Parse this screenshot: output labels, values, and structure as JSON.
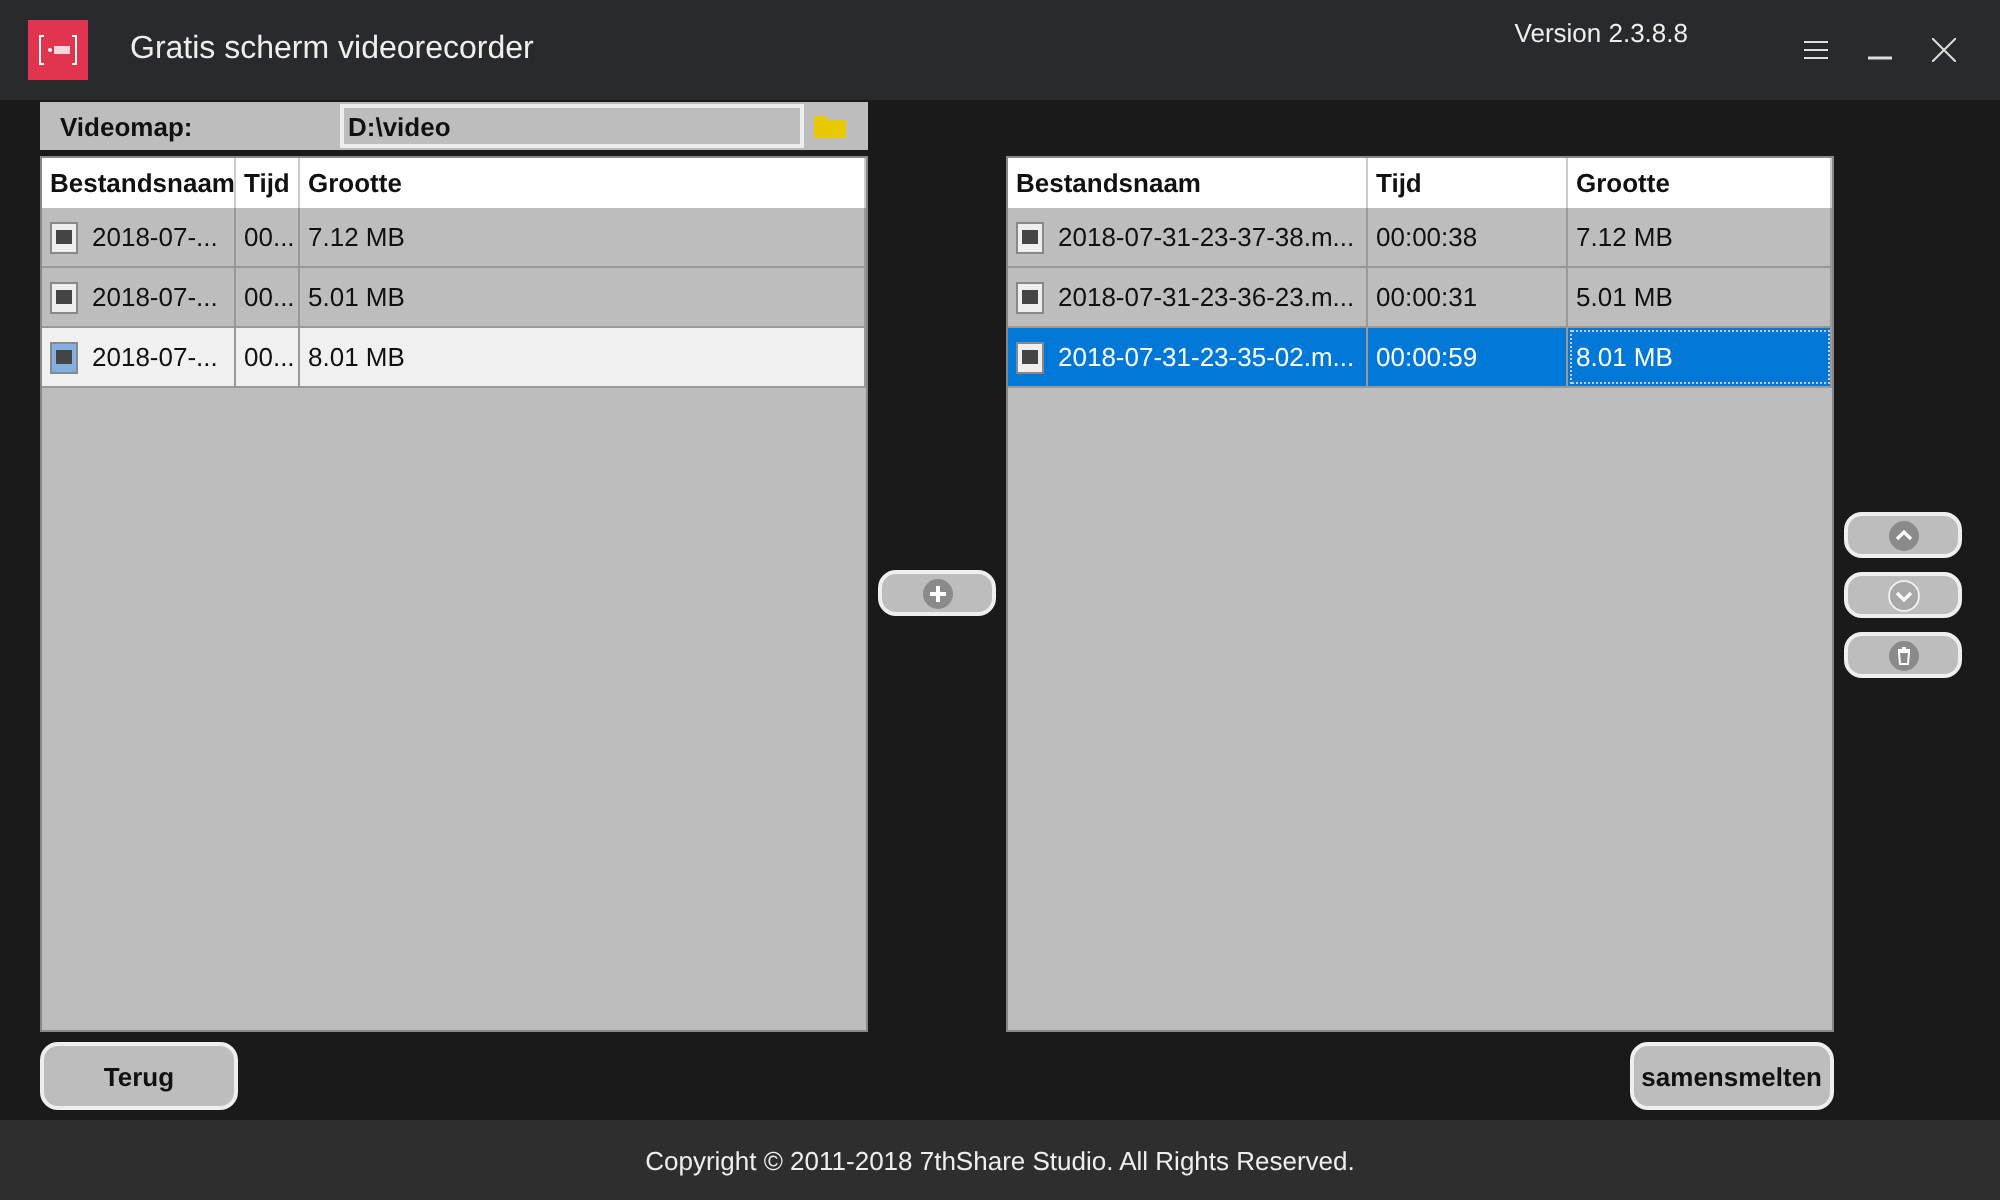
{
  "window": {
    "title": "Gratis scherm videorecorder",
    "version": "Version 2.3.8.8"
  },
  "folder": {
    "label": "Videomap:",
    "value": "D:\\video"
  },
  "left_list": {
    "columns": [
      "Bestandsnaam",
      "Tijd",
      "Grootte"
    ],
    "rows": [
      {
        "name": "2018-07-...",
        "time": "00...",
        "size": "7.12 MB",
        "selected": false
      },
      {
        "name": "2018-07-...",
        "time": "00...",
        "size": "5.01 MB",
        "selected": false
      },
      {
        "name": "2018-07-...",
        "time": "00...",
        "size": "8.01 MB",
        "selected": true
      }
    ]
  },
  "right_list": {
    "columns": [
      "Bestandsnaam",
      "Tijd",
      "Grootte"
    ],
    "rows": [
      {
        "name": "2018-07-31-23-37-38.m...",
        "time": "00:00:38",
        "size": "7.12 MB",
        "selected": false
      },
      {
        "name": "2018-07-31-23-36-23.m...",
        "time": "00:00:31",
        "size": "5.01 MB",
        "selected": false
      },
      {
        "name": "2018-07-31-23-35-02.m...",
        "time": "00:00:59",
        "size": "8.01 MB",
        "selected": true
      }
    ]
  },
  "buttons": {
    "back": "Terug",
    "merge": "samensmelten"
  },
  "footer": "Copyright © 2011-2018 7thShare Studio. All Rights Reserved."
}
